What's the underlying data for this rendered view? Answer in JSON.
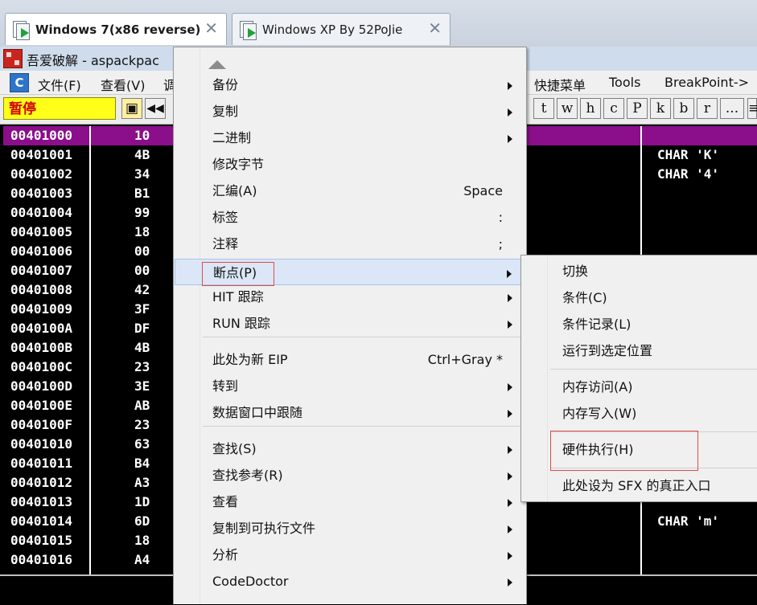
{
  "vm_tabs": [
    {
      "label": "Windows 7(x86 reverse)",
      "active": true
    },
    {
      "label": "Windows XP By 52PoJie",
      "active": false
    }
  ],
  "window": {
    "title": "吾爱破解 - aspackpac"
  },
  "menubar": {
    "items": [
      "文件(F)",
      "查看(V)",
      "调",
      "快捷菜单",
      "Tools",
      "BreakPoint->"
    ]
  },
  "toolbar": {
    "status": "暂停",
    "letter_buttons": [
      "t",
      "w",
      "h",
      "c",
      "P",
      "k",
      "b",
      "r",
      "...",
      "≡"
    ]
  },
  "cpu": {
    "rows": [
      {
        "addr": "00401000",
        "hex": "10",
        "comment": ""
      },
      {
        "addr": "00401001",
        "hex": "4B",
        "comment": "CHAR 'K'"
      },
      {
        "addr": "00401002",
        "hex": "34",
        "comment": "CHAR '4'"
      },
      {
        "addr": "00401003",
        "hex": "B1",
        "comment": ""
      },
      {
        "addr": "00401004",
        "hex": "99",
        "comment": ""
      },
      {
        "addr": "00401005",
        "hex": "18",
        "comment": ""
      },
      {
        "addr": "00401006",
        "hex": "00",
        "comment": ""
      },
      {
        "addr": "00401007",
        "hex": "00",
        "comment": ""
      },
      {
        "addr": "00401008",
        "hex": "42",
        "comment": ""
      },
      {
        "addr": "00401009",
        "hex": "3F",
        "comment": ""
      },
      {
        "addr": "0040100A",
        "hex": "DF",
        "comment": ""
      },
      {
        "addr": "0040100B",
        "hex": "4B",
        "comment": ""
      },
      {
        "addr": "0040100C",
        "hex": "23",
        "comment": ""
      },
      {
        "addr": "0040100D",
        "hex": "3E",
        "comment": ""
      },
      {
        "addr": "0040100E",
        "hex": "AB",
        "comment": ""
      },
      {
        "addr": "0040100F",
        "hex": "23",
        "comment": ""
      },
      {
        "addr": "00401010",
        "hex": "63",
        "comment": ""
      },
      {
        "addr": "00401011",
        "hex": "B4",
        "comment": ""
      },
      {
        "addr": "00401012",
        "hex": "A3",
        "comment": ""
      },
      {
        "addr": "00401013",
        "hex": "1D",
        "comment": ""
      },
      {
        "addr": "00401014",
        "hex": "6D",
        "comment": "CHAR 'm'"
      },
      {
        "addr": "00401015",
        "hex": "18",
        "comment": ""
      },
      {
        "addr": "00401016",
        "hex": "A4",
        "comment": ""
      }
    ],
    "highlight_color": "#8b0e8b"
  },
  "context_menu": {
    "items": [
      {
        "label": "备份",
        "shortcut": "",
        "submenu": true
      },
      {
        "label": "复制",
        "shortcut": "",
        "submenu": true
      },
      {
        "label": "二进制",
        "shortcut": "",
        "submenu": true
      },
      {
        "label": "修改字节",
        "shortcut": "",
        "submenu": false
      },
      {
        "label": "汇编(A)",
        "shortcut": "Space",
        "submenu": false
      },
      {
        "label": "标签",
        "shortcut": ":",
        "submenu": false
      },
      {
        "label": "注释",
        "shortcut": ";",
        "submenu": false
      },
      {
        "label": "断点(P)",
        "shortcut": "",
        "submenu": true
      },
      {
        "label": "HIT 跟踪",
        "shortcut": "",
        "submenu": true
      },
      {
        "label": "RUN 跟踪",
        "shortcut": "",
        "submenu": true
      },
      {
        "label": "此处为新 EIP",
        "shortcut": "Ctrl+Gray *",
        "submenu": false
      },
      {
        "label": "转到",
        "shortcut": "",
        "submenu": true
      },
      {
        "label": "数据窗口中跟随",
        "shortcut": "",
        "submenu": true
      },
      {
        "label": "查找(S)",
        "shortcut": "",
        "submenu": true
      },
      {
        "label": "查找参考(R)",
        "shortcut": "",
        "submenu": true
      },
      {
        "label": "查看",
        "shortcut": "",
        "submenu": true
      },
      {
        "label": "复制到可执行文件",
        "shortcut": "",
        "submenu": true
      },
      {
        "label": "分析",
        "shortcut": "",
        "submenu": true
      },
      {
        "label": "CodeDoctor",
        "shortcut": "",
        "submenu": true
      }
    ]
  },
  "submenu": {
    "items": [
      "切换",
      "条件(C)",
      "条件记录(L)",
      "运行到选定位置",
      "内存访问(A)",
      "内存写入(W)",
      "硬件执行(H)",
      "此处设为 SFX 的真正入口"
    ]
  }
}
